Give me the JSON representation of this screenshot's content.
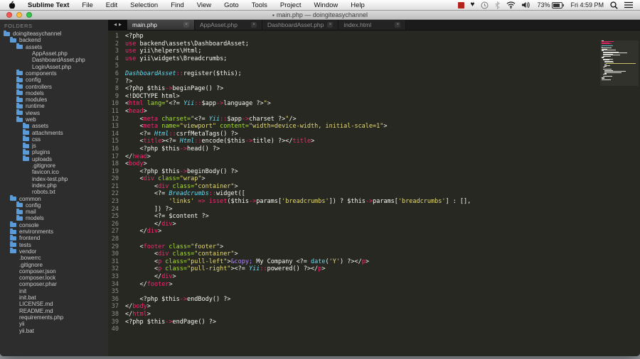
{
  "menubar": {
    "apple_logo": "apple",
    "items": [
      "Sublime Text",
      "File",
      "Edit",
      "Selection",
      "Find",
      "View",
      "Goto",
      "Tools",
      "Project",
      "Window",
      "Help"
    ],
    "status": {
      "battery_percent": "73%",
      "datetime": "Fri 4:59 PM"
    }
  },
  "window": {
    "title": "main.php — doingiteasychannel",
    "modified_indicator": "▪"
  },
  "tabs": [
    {
      "label": "main.php",
      "active": true,
      "close": "×"
    },
    {
      "label": "AppAsset.php",
      "active": false,
      "close": "×"
    },
    {
      "label": "DashboardAsset.php",
      "active": false,
      "close": "×"
    },
    {
      "label": "index.html",
      "active": false,
      "close": "×"
    }
  ],
  "tab_scroll": {
    "left": "◀",
    "right": "▶"
  },
  "sidebar": {
    "header": "FOLDERS",
    "items": [
      {
        "name": "doingiteasychannel",
        "depth": 0,
        "type": "folder"
      },
      {
        "name": "backend",
        "depth": 1,
        "type": "folder"
      },
      {
        "name": "assets",
        "depth": 2,
        "type": "folder"
      },
      {
        "name": "AppAsset.php",
        "depth": 3,
        "type": "file"
      },
      {
        "name": "DashboardAsset.php",
        "depth": 3,
        "type": "file"
      },
      {
        "name": "LoginAsset.php",
        "depth": 3,
        "type": "file"
      },
      {
        "name": "components",
        "depth": 2,
        "type": "folder"
      },
      {
        "name": "config",
        "depth": 2,
        "type": "folder"
      },
      {
        "name": "controllers",
        "depth": 2,
        "type": "folder"
      },
      {
        "name": "models",
        "depth": 2,
        "type": "folder"
      },
      {
        "name": "modules",
        "depth": 2,
        "type": "folder"
      },
      {
        "name": "runtime",
        "depth": 2,
        "type": "folder"
      },
      {
        "name": "views",
        "depth": 2,
        "type": "folder"
      },
      {
        "name": "web",
        "depth": 2,
        "type": "folder"
      },
      {
        "name": "assets",
        "depth": 3,
        "type": "folder"
      },
      {
        "name": "attachments",
        "depth": 3,
        "type": "folder"
      },
      {
        "name": "css",
        "depth": 3,
        "type": "folder"
      },
      {
        "name": "js",
        "depth": 3,
        "type": "folder"
      },
      {
        "name": "plugins",
        "depth": 3,
        "type": "folder"
      },
      {
        "name": "uploads",
        "depth": 3,
        "type": "folder"
      },
      {
        "name": ".gitignore",
        "depth": 3,
        "type": "file"
      },
      {
        "name": "favicon.ico",
        "depth": 3,
        "type": "file"
      },
      {
        "name": "index-test.php",
        "depth": 3,
        "type": "file"
      },
      {
        "name": "index.php",
        "depth": 3,
        "type": "file"
      },
      {
        "name": "robots.txt",
        "depth": 3,
        "type": "file"
      },
      {
        "name": "common",
        "depth": 1,
        "type": "folder"
      },
      {
        "name": "config",
        "depth": 2,
        "type": "folder"
      },
      {
        "name": "mail",
        "depth": 2,
        "type": "folder"
      },
      {
        "name": "models",
        "depth": 2,
        "type": "folder"
      },
      {
        "name": "console",
        "depth": 1,
        "type": "folder"
      },
      {
        "name": "environments",
        "depth": 1,
        "type": "folder"
      },
      {
        "name": "frontend",
        "depth": 1,
        "type": "folder"
      },
      {
        "name": "tests",
        "depth": 1,
        "type": "folder"
      },
      {
        "name": "vendor",
        "depth": 1,
        "type": "folder"
      },
      {
        "name": ".bowerrc",
        "depth": 1,
        "type": "file"
      },
      {
        "name": ".gitignore",
        "depth": 1,
        "type": "file"
      },
      {
        "name": "composer.json",
        "depth": 1,
        "type": "file"
      },
      {
        "name": "composer.lock",
        "depth": 1,
        "type": "file"
      },
      {
        "name": "composer.phar",
        "depth": 1,
        "type": "file"
      },
      {
        "name": "init",
        "depth": 1,
        "type": "file"
      },
      {
        "name": "init.bat",
        "depth": 1,
        "type": "file"
      },
      {
        "name": "LICENSE.md",
        "depth": 1,
        "type": "file"
      },
      {
        "name": "README.md",
        "depth": 1,
        "type": "file"
      },
      {
        "name": "requirements.php",
        "depth": 1,
        "type": "file"
      },
      {
        "name": "yii",
        "depth": 1,
        "type": "file"
      },
      {
        "name": "yii.bat",
        "depth": 1,
        "type": "file"
      }
    ]
  },
  "editor": {
    "token_colors": {
      "w": "#f8f8f2",
      "p": "#f92672",
      "g": "#a6e22e",
      "y": "#e6db74",
      "c": "#66d9ef",
      "d": "#66d9ef",
      "pu": "#ae81ff"
    },
    "lines": [
      [
        [
          "w",
          "<?php"
        ]
      ],
      [
        [
          "p",
          "use "
        ],
        [
          "w",
          "backend\\assets\\DashboardAsset;"
        ]
      ],
      [
        [
          "p",
          "use "
        ],
        [
          "w",
          "yii\\helpers\\Html;"
        ]
      ],
      [
        [
          "p",
          "use "
        ],
        [
          "w",
          "yii\\widgets\\Breadcrumbs;"
        ]
      ],
      [],
      [
        [
          "c",
          "DashboardAsset"
        ],
        [
          "p",
          "::"
        ],
        [
          "w",
          "register($this);"
        ]
      ],
      [
        [
          "w",
          "?>"
        ]
      ],
      [
        [
          "w",
          "<?php $this"
        ],
        [
          "p",
          "->"
        ],
        [
          "w",
          "beginPage() ?>"
        ]
      ],
      [
        [
          "w",
          "<!DOCTYPE html>"
        ]
      ],
      [
        [
          "w",
          "<"
        ],
        [
          "p",
          "html"
        ],
        [
          "g",
          " lang="
        ],
        [
          "y",
          "\""
        ],
        [
          "w",
          "<?= "
        ],
        [
          "c",
          "Yii"
        ],
        [
          "p",
          "::"
        ],
        [
          "w",
          "$app"
        ],
        [
          "p",
          "->"
        ],
        [
          "w",
          "language ?>"
        ],
        [
          "y",
          "\""
        ],
        [
          "w",
          ">"
        ]
      ],
      [
        [
          "w",
          "<"
        ],
        [
          "p",
          "head"
        ],
        [
          "w",
          ">"
        ]
      ],
      [
        [
          "w",
          "    <"
        ],
        [
          "p",
          "meta"
        ],
        [
          "g",
          " charset="
        ],
        [
          "y",
          "\""
        ],
        [
          "w",
          "<?= "
        ],
        [
          "c",
          "Yii"
        ],
        [
          "p",
          "::"
        ],
        [
          "w",
          "$app"
        ],
        [
          "p",
          "->"
        ],
        [
          "w",
          "charset ?>"
        ],
        [
          "y",
          "\""
        ],
        [
          "w",
          "/>"
        ]
      ],
      [
        [
          "w",
          "    <"
        ],
        [
          "p",
          "meta"
        ],
        [
          "g",
          " name="
        ],
        [
          "y",
          "\"viewport\""
        ],
        [
          "g",
          " content="
        ],
        [
          "y",
          "\"width=device-width, initial-scale=1\""
        ],
        [
          "w",
          ">"
        ]
      ],
      [
        [
          "w",
          "    <?= "
        ],
        [
          "c",
          "Html"
        ],
        [
          "p",
          "::"
        ],
        [
          "w",
          "csrfMetaTags() ?>"
        ]
      ],
      [
        [
          "w",
          "    <"
        ],
        [
          "p",
          "title"
        ],
        [
          "w",
          "><?= "
        ],
        [
          "c",
          "Html"
        ],
        [
          "p",
          "::"
        ],
        [
          "w",
          "encode($this"
        ],
        [
          "p",
          "->"
        ],
        [
          "w",
          "title) ?></"
        ],
        [
          "p",
          "title"
        ],
        [
          "w",
          ">"
        ]
      ],
      [
        [
          "w",
          "    <?php $this"
        ],
        [
          "p",
          "->"
        ],
        [
          "w",
          "head() ?>"
        ]
      ],
      [
        [
          "w",
          "</"
        ],
        [
          "p",
          "head"
        ],
        [
          "w",
          ">"
        ]
      ],
      [
        [
          "w",
          "<"
        ],
        [
          "p",
          "body"
        ],
        [
          "w",
          ">"
        ]
      ],
      [
        [
          "w",
          "    <?php $this"
        ],
        [
          "p",
          "->"
        ],
        [
          "w",
          "beginBody() ?>"
        ]
      ],
      [
        [
          "w",
          "    <"
        ],
        [
          "p",
          "div"
        ],
        [
          "g",
          " class="
        ],
        [
          "y",
          "\"wrap\""
        ],
        [
          "w",
          ">"
        ]
      ],
      [
        [
          "w",
          "        <"
        ],
        [
          "p",
          "div"
        ],
        [
          "g",
          " class="
        ],
        [
          "y",
          "\"container\""
        ],
        [
          "w",
          ">"
        ]
      ],
      [
        [
          "w",
          "        <?= "
        ],
        [
          "c",
          "Breadcrumbs"
        ],
        [
          "p",
          "::"
        ],
        [
          "w",
          "widget(["
        ]
      ],
      [
        [
          "w",
          "            "
        ],
        [
          "y",
          "'links'"
        ],
        [
          "p",
          " => "
        ],
        [
          "p",
          "isset"
        ],
        [
          "w",
          "($this"
        ],
        [
          "p",
          "->"
        ],
        [
          "w",
          "params["
        ],
        [
          "y",
          "'breadcrumbs'"
        ],
        [
          "w",
          "]) ? $this"
        ],
        [
          "p",
          "->"
        ],
        [
          "w",
          "params["
        ],
        [
          "y",
          "'breadcrumbs'"
        ],
        [
          "w",
          "] : [],"
        ]
      ],
      [
        [
          "w",
          "        ]) ?>"
        ]
      ],
      [
        [
          "w",
          "        <?= $content ?>"
        ]
      ],
      [
        [
          "w",
          "        </"
        ],
        [
          "p",
          "div"
        ],
        [
          "w",
          ">"
        ]
      ],
      [
        [
          "w",
          "    </"
        ],
        [
          "p",
          "div"
        ],
        [
          "w",
          ">"
        ]
      ],
      [],
      [
        [
          "w",
          "    <"
        ],
        [
          "p",
          "footer"
        ],
        [
          "g",
          " class="
        ],
        [
          "y",
          "\"footer\""
        ],
        [
          "w",
          ">"
        ]
      ],
      [
        [
          "w",
          "        <"
        ],
        [
          "p",
          "div"
        ],
        [
          "g",
          " class="
        ],
        [
          "y",
          "\"container\""
        ],
        [
          "w",
          ">"
        ]
      ],
      [
        [
          "w",
          "        <"
        ],
        [
          "p",
          "p"
        ],
        [
          "g",
          " class="
        ],
        [
          "y",
          "\"pull-left\""
        ],
        [
          "w",
          ">"
        ],
        [
          "pu",
          "&copy;"
        ],
        [
          "w",
          " My Company <?= "
        ],
        [
          "d",
          "date"
        ],
        [
          "w",
          "("
        ],
        [
          "y",
          "'Y'"
        ],
        [
          "w",
          ") ?></"
        ],
        [
          "p",
          "p"
        ],
        [
          "w",
          ">"
        ]
      ],
      [
        [
          "w",
          "        <"
        ],
        [
          "p",
          "p"
        ],
        [
          "g",
          " class="
        ],
        [
          "y",
          "\"pull-right\""
        ],
        [
          "w",
          "><?= "
        ],
        [
          "c",
          "Yii"
        ],
        [
          "p",
          "::"
        ],
        [
          "w",
          "powered() ?></"
        ],
        [
          "p",
          "p"
        ],
        [
          "w",
          ">"
        ]
      ],
      [
        [
          "w",
          "        </"
        ],
        [
          "p",
          "div"
        ],
        [
          "w",
          ">"
        ]
      ],
      [
        [
          "w",
          "    </"
        ],
        [
          "p",
          "footer"
        ],
        [
          "w",
          ">"
        ]
      ],
      [],
      [
        [
          "w",
          "    <?php $this"
        ],
        [
          "p",
          "->"
        ],
        [
          "w",
          "endBody() ?>"
        ]
      ],
      [
        [
          "w",
          "</"
        ],
        [
          "p",
          "body"
        ],
        [
          "w",
          ">"
        ]
      ],
      [
        [
          "w",
          "</"
        ],
        [
          "p",
          "html"
        ],
        [
          "w",
          ">"
        ]
      ],
      [
        [
          "w",
          "<?php $this"
        ],
        [
          "p",
          "->"
        ],
        [
          "w",
          "endPage() ?>"
        ]
      ],
      []
    ]
  }
}
